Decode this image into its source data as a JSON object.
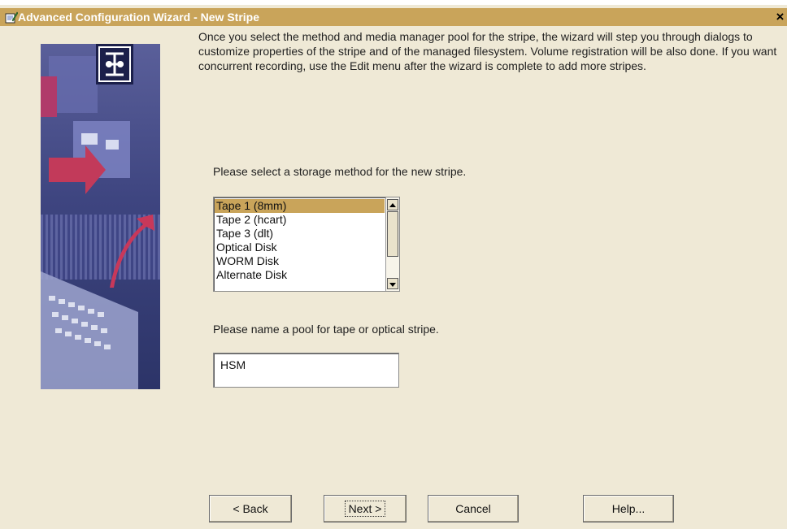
{
  "window": {
    "title": "Advanced Configuration Wizard - New Stripe",
    "close_label": "×"
  },
  "instructions": "Once you select the method and media manager pool for the stripe, the wizard will step you through dialogs to customize properties of the stripe and of the managed filesystem.  Volume registration will be also done.  If you want concurrent recording, use the Edit menu after the wizard is complete to add more stripes.",
  "method": {
    "label": "Please select a storage method for the new stripe.",
    "options": [
      "Tape 1 (8mm)",
      "Tape 2 (hcart)",
      "Tape 3 (dlt)",
      "Optical Disk",
      "WORM Disk",
      "Alternate Disk"
    ],
    "selected_index": 0
  },
  "pool": {
    "label": "Please name a pool for tape or optical stripe.",
    "value": "HSM"
  },
  "buttons": {
    "back": "< Back",
    "next": "Next >",
    "cancel": "Cancel",
    "help": "Help..."
  },
  "colors": {
    "titlebar": "#c9a45a",
    "background": "#efe9d6",
    "selection": "#c9a45a"
  }
}
